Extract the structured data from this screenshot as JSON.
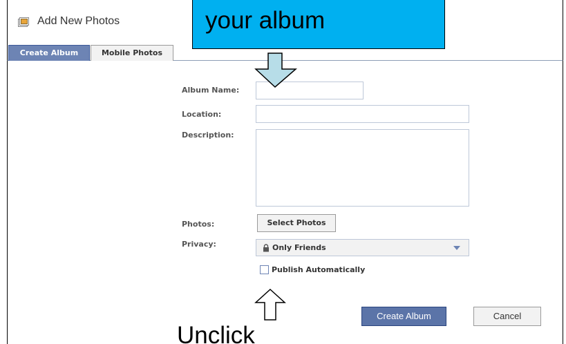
{
  "header": {
    "title": "Add New Photos",
    "icon": "photo-album-icon"
  },
  "callout": {
    "text": "your album",
    "color": "#00b0f0"
  },
  "tabs": [
    {
      "label": "Create Album",
      "active": true
    },
    {
      "label": "Mobile Photos",
      "active": false
    }
  ],
  "form": {
    "album_name_label": "Album Name:",
    "album_name_value": "",
    "location_label": "Location:",
    "location_value": "",
    "description_label": "Description:",
    "description_value": "",
    "photos_label": "Photos:",
    "select_photos_button": "Select Photos",
    "privacy_label": "Privacy:",
    "privacy_value": "Only Friends",
    "publish_auto_label": "Publish Automatically",
    "publish_auto_checked": false
  },
  "actions": {
    "create_album_button": "Create Album",
    "cancel_button": "Cancel"
  },
  "annotations": {
    "bottom_text": "Unclick"
  },
  "colors": {
    "accent": "#6d84b4",
    "primary_button": "#5b74a8",
    "callout": "#00b0f0",
    "arrow_fill": "#b7dde8"
  }
}
